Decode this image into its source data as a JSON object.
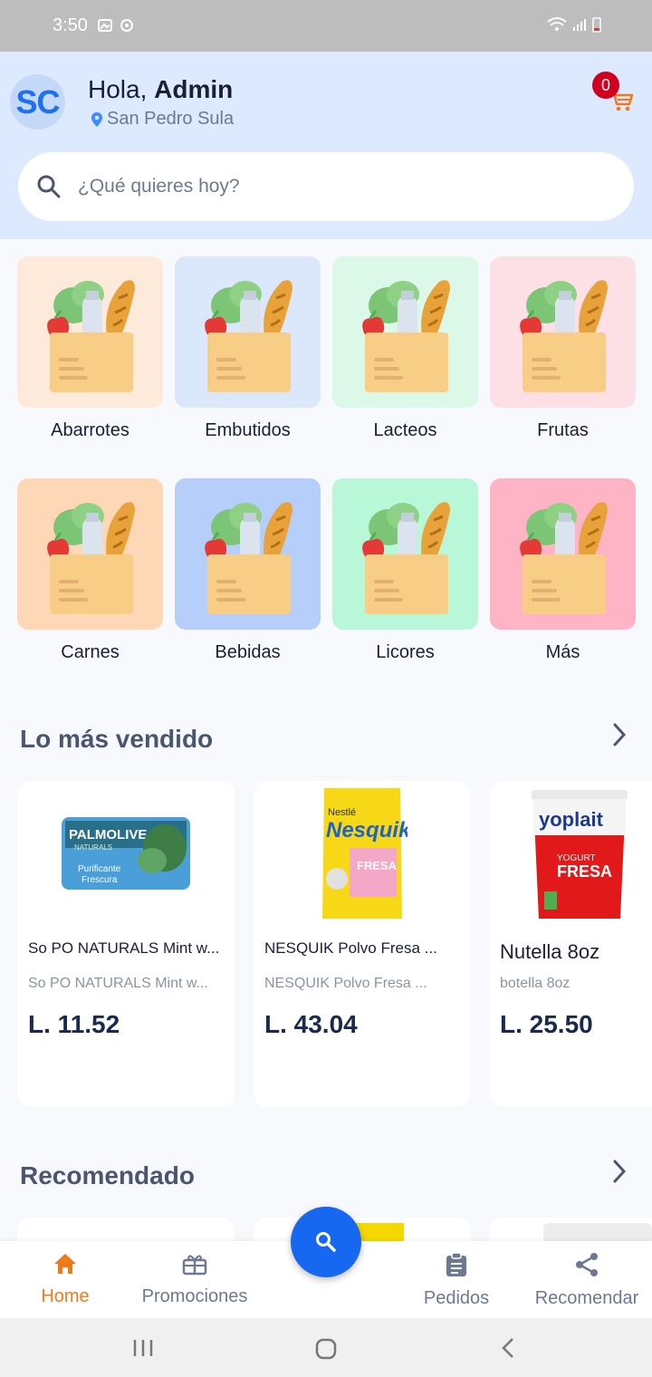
{
  "status": {
    "time": "3:50"
  },
  "header": {
    "avatar_initials": "SC",
    "greeting_prefix": "Hola, ",
    "user_name": "Admin",
    "location": "San Pedro Sula",
    "cart_count": "0"
  },
  "search": {
    "placeholder": "¿Qué quieres hoy?"
  },
  "categories": [
    {
      "label": "Abarrotes",
      "color": "#fdeadb"
    },
    {
      "label": "Embutidos",
      "color": "#dbe7fb"
    },
    {
      "label": "Lacteos",
      "color": "#dbf8e9"
    },
    {
      "label": "Frutas",
      "color": "#fde0e6"
    },
    {
      "label": "Carnes",
      "color": "#fed7b7"
    },
    {
      "label": "Bebidas",
      "color": "#b5cffa"
    },
    {
      "label": "Licores",
      "color": "#b8f7d8"
    },
    {
      "label": "Más",
      "color": "#feb4c5"
    }
  ],
  "best_sellers": {
    "title": "Lo más vendido",
    "products": [
      {
        "name": "So PO NATURALS Mint w...",
        "desc": "So PO NATURALS Mint w...",
        "price": "L. 11.52",
        "brand": "PALMOLIVE",
        "sub": "NATURALS"
      },
      {
        "name": "NESQUIK Polvo Fresa ...",
        "desc": "NESQUIK Polvo Fresa ...",
        "price": "L. 43.04",
        "brand": "Nesquik",
        "sub": "FRESA"
      },
      {
        "name": "Nutella 8oz",
        "desc": "botella 8oz",
        "price": "L. 25.50",
        "brand": "yoplait",
        "sub": "FRESA"
      }
    ]
  },
  "recommended": {
    "title": "Recomendado"
  },
  "nav": {
    "home": "Home",
    "promos": "Promociones",
    "orders": "Pedidos",
    "recommend": "Recomendar"
  },
  "colors": {
    "accent": "#1668f0",
    "nav_active": "#f07a18",
    "badge": "#d2001f",
    "header_bg": "#dce9ff"
  }
}
